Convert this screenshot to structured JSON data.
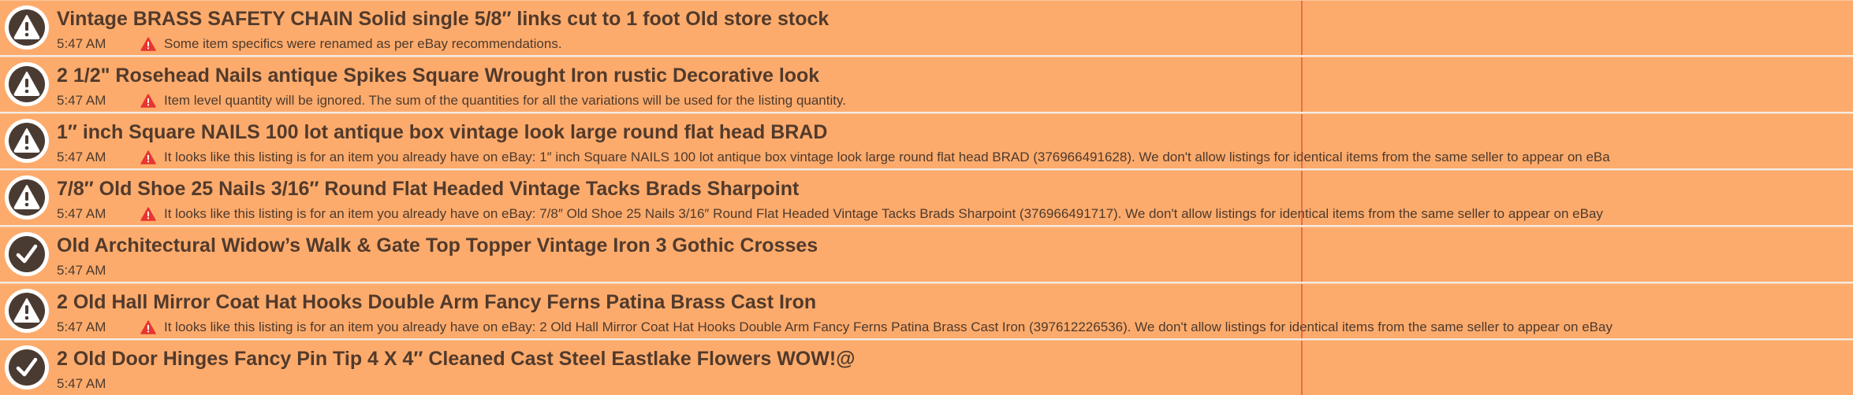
{
  "listings": [
    {
      "status": "warning",
      "status_icon": "exclamation-icon",
      "title": "Vintage BRASS SAFETY CHAIN Solid single 5/8″ links cut to 1 foot Old store stock",
      "time": "5:47 AM",
      "message": "Some item specifics were renamed as per eBay recommendations."
    },
    {
      "status": "warning",
      "status_icon": "exclamation-icon",
      "title": "2 1/2\" Rosehead Nails antique Spikes Square Wrought Iron rustic Decorative look",
      "time": "5:47 AM",
      "message": "Item level quantity will be ignored. The sum of the quantities for all the variations will be used for the listing quantity."
    },
    {
      "status": "warning",
      "status_icon": "exclamation-icon",
      "title": "1″ inch Square NAILS 100 lot antique box vintage look large round flat head BRAD",
      "time": "5:47 AM",
      "message": "It looks like this listing is for an item you already have on eBay: 1″ inch Square NAILS 100 lot antique box vintage look large round flat head BRAD (376966491628). We don't allow listings for identical items from the same seller to appear on eBa"
    },
    {
      "status": "warning",
      "status_icon": "exclamation-icon",
      "title": "7/8″ Old Shoe 25 Nails 3/16″ Round Flat Headed Vintage Tacks Brads Sharpoint",
      "time": "5:47 AM",
      "message": "It looks like this listing is for an item you already have on eBay: 7/8″ Old Shoe 25 Nails 3/16″ Round Flat Headed Vintage Tacks Brads Sharpoint (376966491717). We don't allow listings for identical items from the same seller to appear on eBay"
    },
    {
      "status": "success",
      "status_icon": "checkmark-icon",
      "title": "Old Architectural Widow’s Walk & Gate Top Topper Vintage Iron 3 Gothic Crosses",
      "time": "5:47 AM",
      "message": ""
    },
    {
      "status": "warning",
      "status_icon": "exclamation-icon",
      "title": "2 Old Hall Mirror Coat Hat Hooks Double Arm Fancy Ferns Patina Brass Cast Iron",
      "time": "5:47 AM",
      "message": "It looks like this listing is for an item you already have on eBay: 2 Old Hall Mirror Coat Hat Hooks Double Arm Fancy Ferns Patina Brass Cast Iron (397612226536). We don't allow listings for identical items from the same seller to appear on eBay"
    },
    {
      "status": "success",
      "status_icon": "checkmark-icon",
      "title": "2 Old Door Hinges Fancy Pin Tip 4 X 4″ Cleaned Cast Steel Eastlake Flowers WOW!@",
      "time": "5:47 AM",
      "message": ""
    }
  ],
  "colors": {
    "row_background": "#fdab6c",
    "text": "#513a2c",
    "status_icon_fill": "#4a3b32",
    "warning_icon": "#e8352f"
  }
}
